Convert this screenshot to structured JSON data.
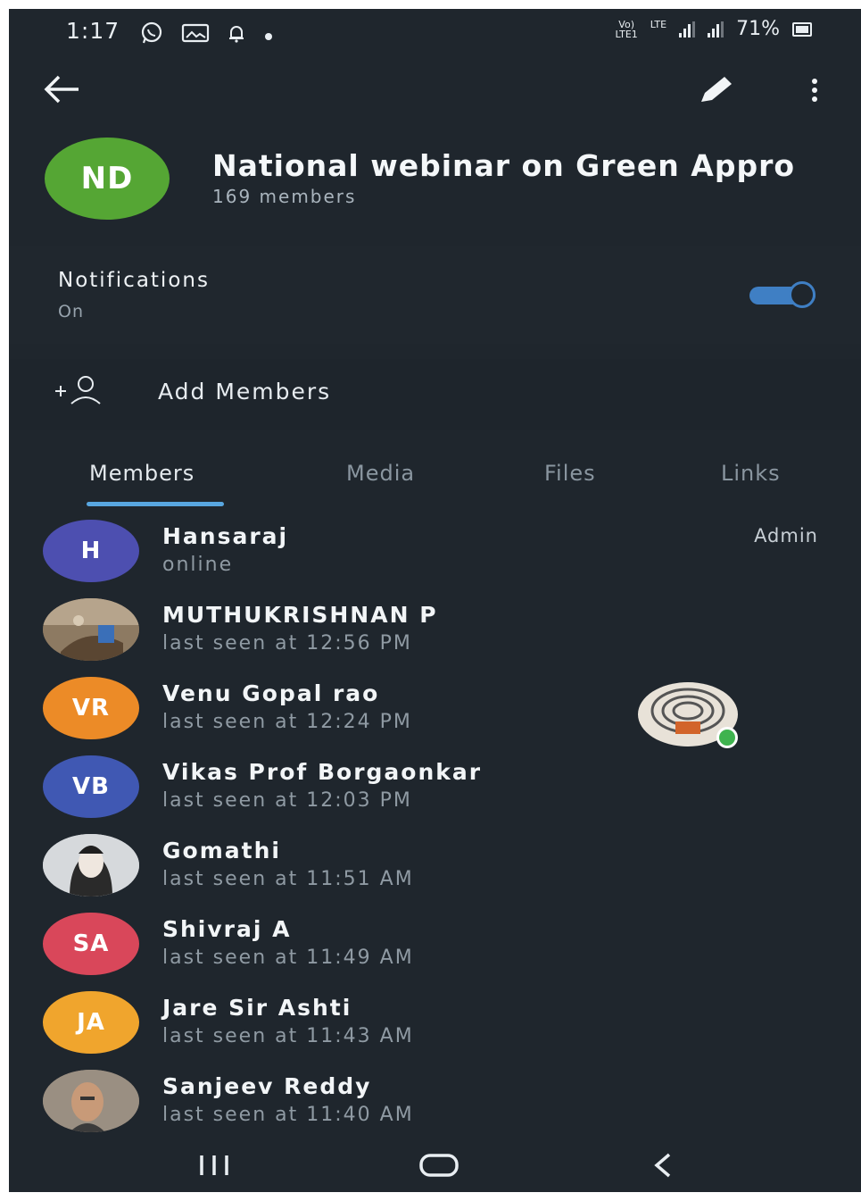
{
  "status_bar": {
    "time": "1:17",
    "network_top": "Vo)",
    "network_bottom": "LTE1",
    "lte": "LTE",
    "battery": "71%"
  },
  "toolbar": {
    "back_icon": "arrow-left-icon",
    "edit_icon": "pencil-icon",
    "more_icon": "more-vertical-icon"
  },
  "group": {
    "initials": "ND",
    "avatar_color": "#55a634",
    "title": "National webinar on Green Appro",
    "subtitle": "169 members"
  },
  "notifications": {
    "label": "Notifications",
    "status": "On",
    "enabled": true
  },
  "add_members": {
    "label": "Add Members"
  },
  "tabs": [
    {
      "label": "Members",
      "active": true
    },
    {
      "label": "Media",
      "active": false
    },
    {
      "label": "Files",
      "active": false
    },
    {
      "label": "Links",
      "active": false
    }
  ],
  "members": [
    {
      "initials": "H",
      "color": "#4d4fb0",
      "name": "Hansaraj",
      "status": "online",
      "role": "Admin"
    },
    {
      "initials": "",
      "color": "#7b6a55",
      "name": "MUTHUKRISHNAN P",
      "status": "last seen at 12:56 PM",
      "role": ""
    },
    {
      "initials": "VR",
      "color": "#ec8b27",
      "name": "Venu Gopal rao",
      "status": "last seen at 12:24 PM",
      "role": ""
    },
    {
      "initials": "VB",
      "color": "#4058b3",
      "name": "Vikas Prof Borgaonkar",
      "status": "last seen at 12:03 PM",
      "role": ""
    },
    {
      "initials": "",
      "color": "#cfd3d6",
      "name": "Gomathi",
      "status": "last seen at 11:51 AM",
      "role": ""
    },
    {
      "initials": "SA",
      "color": "#d9475a",
      "name": "Shivraj A",
      "status": "last seen at 11:49 AM",
      "role": ""
    },
    {
      "initials": "JA",
      "color": "#f0a52d",
      "name": "Jare Sir Ashti",
      "status": "last seen at 11:43 AM",
      "role": ""
    },
    {
      "initials": "",
      "color": "#8a7a6a",
      "name": "Sanjeev Reddy",
      "status": "last seen at 11:40 AM",
      "role": ""
    }
  ],
  "colors": {
    "background": "#1f262d",
    "accent": "#58a6e0",
    "toggle": "#3f7fc4"
  },
  "nav": {
    "recent_icon": "recent-apps-icon",
    "home_icon": "home-icon",
    "back_icon": "nav-back-icon"
  }
}
